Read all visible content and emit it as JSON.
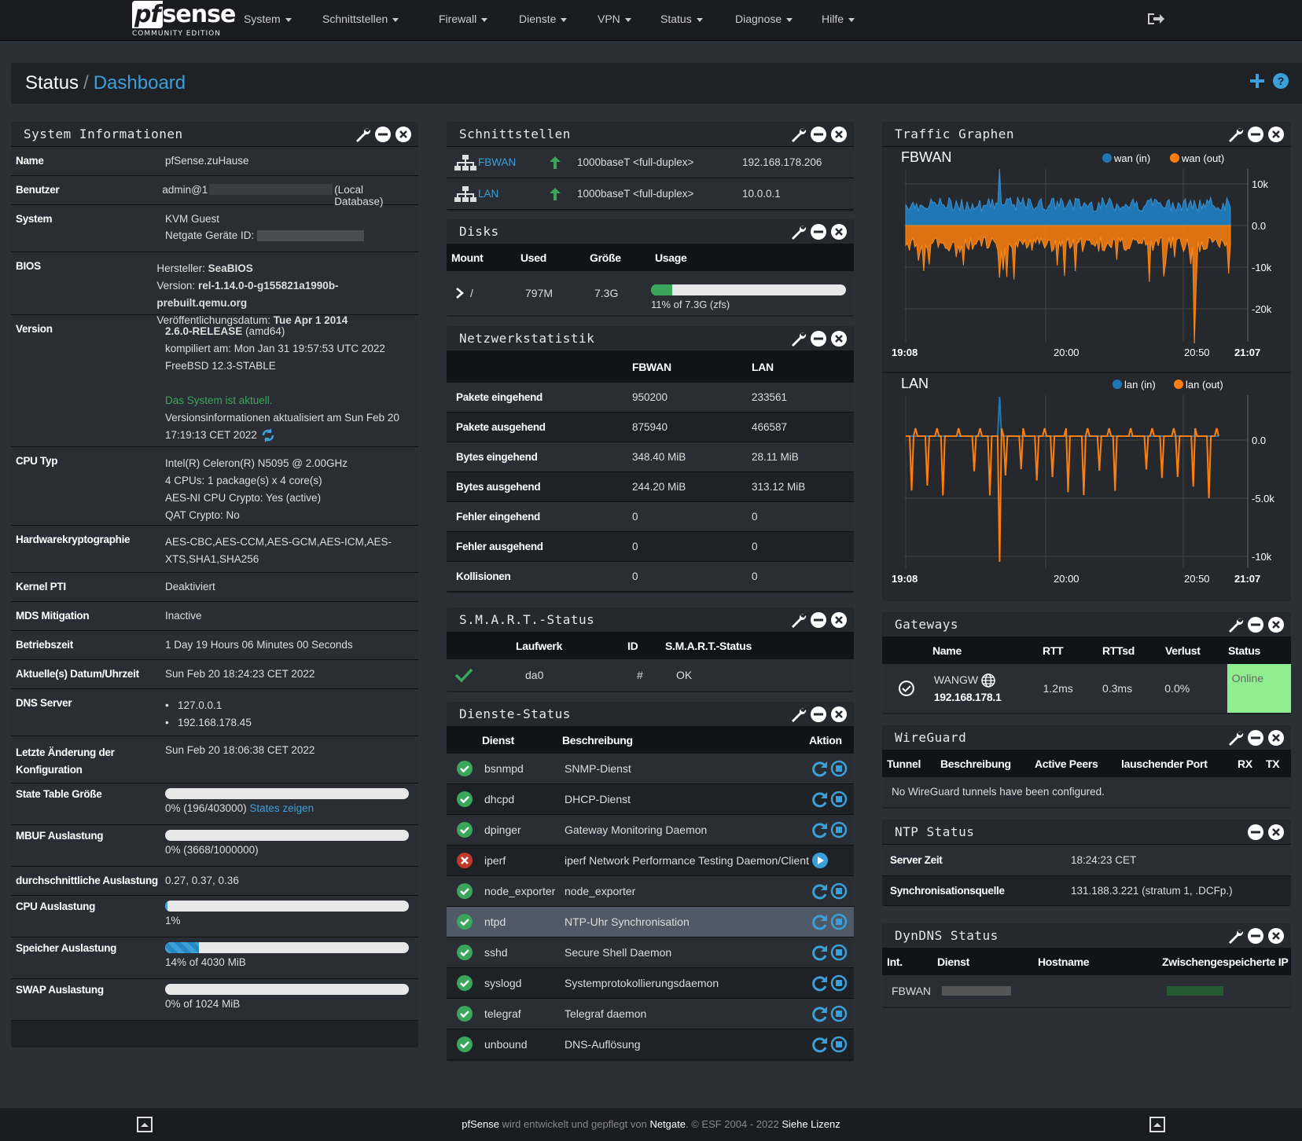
{
  "nav": {
    "logo_main": "pfsense",
    "logo_pf": "pf",
    "logo_rest": "sense",
    "logo_sub": "COMMUNITY EDITION",
    "menu": [
      "System",
      "Schnittstellen",
      "Firewall",
      "Dienste",
      "VPN",
      "Status",
      "Diagnose",
      "Hilfe"
    ]
  },
  "breadcrumb": {
    "parent": "Status",
    "separator": "/",
    "current": "Dashboard"
  },
  "sysinfo": {
    "title": "System Informationen",
    "name_label": "Name",
    "name": "pfSense.zuHause",
    "user_label": "Benutzer",
    "user_prefix": "admin@1",
    "user_suffix": "(Local Database)",
    "system_label": "System",
    "system_line1": "KVM Guest",
    "system_line2": "Netgate Geräte ID:",
    "bios_label": "BIOS",
    "bios_vendor_k": "Hersteller:",
    "bios_vendor": "SeaBIOS",
    "bios_version_k": "Version:",
    "bios_version": "rel-1.14.0-0-g155821a1990b-prebuilt.qemu.org",
    "bios_date_k": "Veröffentlichungsdatum:",
    "bios_date": "Tue Apr 1 2014",
    "version_label": "Version",
    "version_main": "2.6.0-RELEASE",
    "version_arch": "(amd64)",
    "version_built": "kompiliert am: Mon Jan 31 19:57:53 UTC 2022",
    "version_os": "FreeBSD 12.3-STABLE",
    "version_status": "Das System ist aktuell.",
    "version_updated1": "Versionsinformationen aktualisiert am Sun Feb 20",
    "version_updated2": "17:19:13 CET 2022",
    "cpu_label": "CPU Typ",
    "cpu_1": "Intel(R) Celeron(R) N5095 @ 2.00GHz",
    "cpu_2": "4 CPUs: 1 package(s) x 4 core(s)",
    "cpu_3": "AES-NI CPU Crypto: Yes (active)",
    "cpu_4": "QAT Crypto: No",
    "hwcrypto_label": "Hardwarekryptographie",
    "hwcrypto_1": "AES-CBC,AES-CCM,AES-GCM,AES-ICM,AES-",
    "hwcrypto_2": "XTS,SHA1,SHA256",
    "pti_label": "Kernel PTI",
    "pti": "Deaktiviert",
    "mds_label": "MDS Mitigation",
    "mds": "Inactive",
    "uptime_label": "Betriebszeit",
    "uptime": "1 Day 19 Hours 06 Minutes 00 Seconds",
    "datetime_label": "Aktuelle(s) Datum/Uhrzeit",
    "datetime": "Sun Feb 20 18:24:23 CET 2022",
    "dns_label": "DNS Server",
    "dns": [
      "127.0.0.1",
      "192.168.178.45"
    ],
    "lastcfg_label1": "Letzte Änderung der",
    "lastcfg_label2": "Konfiguration",
    "lastcfg": "Sun Feb 20 18:06:38 CET 2022",
    "state_label": "State Table Größe",
    "state_text": "0% (196/403000)",
    "state_link": "States zeigen",
    "state_pct": 0,
    "mbuf_label": "MBUF Auslastung",
    "mbuf_text": "0% (3668/1000000)",
    "mbuf_pct": 0,
    "load_label": "durchschnittliche Auslastung",
    "load": "0.27, 0.37, 0.36",
    "cpuuse_label": "CPU Auslastung",
    "cpuuse_text": "1%",
    "cpuuse_pct": 1,
    "mem_label": "Speicher Auslastung",
    "mem_text": "14% of 4030 MiB",
    "mem_pct": 14,
    "swap_label": "SWAP Auslastung",
    "swap_text": "0% of 1024 MiB",
    "swap_pct": 0
  },
  "interfaces": {
    "title": "Schnittstellen",
    "rows": [
      {
        "name": "FBWAN",
        "media": "1000baseT <full-duplex>",
        "ip": "192.168.178.206"
      },
      {
        "name": "LAN",
        "media": "1000baseT <full-duplex>",
        "ip": "10.0.0.1"
      }
    ]
  },
  "disks": {
    "title": "Disks",
    "headers": [
      "Mount",
      "Used",
      "Größe",
      "Usage"
    ],
    "row": {
      "mount": "/",
      "used": "797M",
      "size": "7.3G",
      "usage_text": "11% of 7.3G (zfs)",
      "usage_pct": 11
    }
  },
  "netstat": {
    "title": "Netzwerkstatistik",
    "cols": [
      "FBWAN",
      "LAN"
    ],
    "rows": [
      {
        "label": "Pakete eingehend",
        "wan": "950200",
        "lan": "233561"
      },
      {
        "label": "Pakete ausgehend",
        "wan": "875940",
        "lan": "466587"
      },
      {
        "label": "Bytes eingehend",
        "wan": "348.40 MiB",
        "lan": "28.11 MiB"
      },
      {
        "label": "Bytes ausgehend",
        "wan": "244.20 MiB",
        "lan": "313.12 MiB"
      },
      {
        "label": "Fehler eingehend",
        "wan": "0",
        "lan": "0"
      },
      {
        "label": "Fehler ausgehend",
        "wan": "0",
        "lan": "0"
      },
      {
        "label": "Kollisionen",
        "wan": "0",
        "lan": "0"
      }
    ]
  },
  "smart": {
    "title": "S.M.A.R.T.-Status",
    "headers": [
      "Laufwerk",
      "ID",
      "S.M.A.R.T.-Status"
    ],
    "row": {
      "drive": "da0",
      "id": "#",
      "status": "OK"
    }
  },
  "services": {
    "title": "Dienste-Status",
    "headers": [
      "Dienst",
      "Beschreibung",
      "Aktion"
    ],
    "rows": [
      {
        "name": "bsnmpd",
        "desc": "SNMP-Dienst",
        "running": true
      },
      {
        "name": "dhcpd",
        "desc": "DHCP-Dienst",
        "running": true
      },
      {
        "name": "dpinger",
        "desc": "Gateway Monitoring Daemon",
        "running": true
      },
      {
        "name": "iperf",
        "desc": "iperf Network Performance Testing Daemon/Client",
        "running": false
      },
      {
        "name": "node_exporter",
        "desc": "node_exporter",
        "running": true
      },
      {
        "name": "ntpd",
        "desc": "NTP-Uhr Synchronisation",
        "running": true
      },
      {
        "name": "sshd",
        "desc": "Secure Shell Daemon",
        "running": true
      },
      {
        "name": "syslogd",
        "desc": "Systemprotokollierungsdaemon",
        "running": true
      },
      {
        "name": "telegraf",
        "desc": "Telegraf daemon",
        "running": true
      },
      {
        "name": "unbound",
        "desc": "DNS-Auflösung",
        "running": true
      }
    ]
  },
  "traffic": {
    "title": "Traffic Graphen",
    "wan": {
      "name": "FBWAN",
      "legend_in": "wan (in)",
      "legend_out": "wan (out)",
      "yticks": [
        "10k",
        "0.0",
        "-10k",
        "-20k"
      ],
      "xticks": [
        "19:08",
        "20:00",
        "20:50",
        "21:07"
      ]
    },
    "lan": {
      "name": "LAN",
      "legend_in": "lan (in)",
      "legend_out": "lan (out)",
      "yticks": [
        "0.0",
        "-5.0k",
        "-10k"
      ],
      "xticks": [
        "19:08",
        "20:00",
        "20:50",
        "21:07"
      ]
    },
    "color_in": "#1f77b4",
    "color_out": "#ff7f0e"
  },
  "gateways": {
    "title": "Gateways",
    "headers": [
      "Name",
      "RTT",
      "RTTsd",
      "Verlust",
      "Status"
    ],
    "row": {
      "name": "WANGW",
      "ip": "192.168.178.1",
      "rtt": "1.2ms",
      "rttsd": "0.3ms",
      "loss": "0.0%",
      "status": "Online"
    }
  },
  "wireguard": {
    "title": "WireGuard",
    "headers": [
      "Tunnel",
      "Beschreibung",
      "Active Peers",
      "lauschender Port",
      "RX",
      "TX"
    ],
    "empty": "No WireGuard tunnels have been configured."
  },
  "ntp": {
    "title": "NTP Status",
    "server_label": "Server Zeit",
    "server": "18:24:23 CET",
    "source_label": "Synchronisationsquelle",
    "source": "131.188.3.221 (stratum 1, .DCFp.)"
  },
  "dyndns": {
    "title": "DynDNS Status",
    "headers": [
      "Int.",
      "Dienst",
      "Hostname",
      "Zwischengespeicherte IP"
    ],
    "row": {
      "int": "FBWAN"
    }
  },
  "footer": {
    "brand": "pfSense",
    "text1": " wird entwickelt und gepflegt von ",
    "company": "Netgate",
    "text2": ". © ESF 2004 - 2022 ",
    "license": "Siehe Lizenz"
  }
}
